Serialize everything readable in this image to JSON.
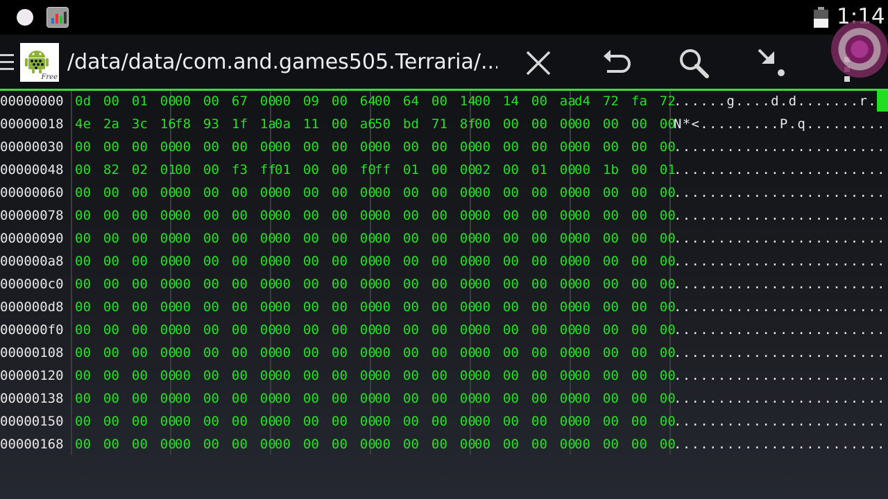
{
  "status_bar": {
    "time": "1:14",
    "icons": [
      "notification-dot-icon",
      "app-notification-icon",
      "battery-icon"
    ]
  },
  "action_bar": {
    "title": "/data/data/com.and.games505.Terraria/...",
    "app_logo_badge": "Free",
    "actions": [
      "close-icon",
      "undo-icon",
      "search-icon",
      "goto-icon",
      "overflow-menu-icon"
    ]
  },
  "colors": {
    "hex_text": "#22e022",
    "accent_line": "#33e233",
    "address_text": "#e8e8e8"
  },
  "rows": [
    {
      "addr": "00000000",
      "g": [
        "0d 00 01 00",
        "00 00 67 00",
        "00 09 00 64",
        "00 64 00 14",
        "00 14 00 aa",
        "d4 72 fa 72"
      ],
      "ascii": "......g....d.d.......r.r"
    },
    {
      "addr": "00000018",
      "g": [
        "4e 2a 3c 16",
        "f8 93 1f 1a",
        "0a 11 00 a6",
        "50 bd 71 8f",
        "00 00 00 00",
        "00 00 00 00"
      ],
      "ascii": "N*<.........P.q........."
    },
    {
      "addr": "00000030",
      "g": [
        "00 00 00 00",
        "00 00 00 00",
        "00 00 00 00",
        "00 00 00 00",
        "00 00 00 00",
        "00 00 00 00"
      ],
      "ascii": "........................"
    },
    {
      "addr": "00000048",
      "g": [
        "00 82 02 01",
        "00 00 f3 ff",
        "01 00 00 f0",
        "ff 01 00 00",
        "02 00 01 00",
        "00 1b 00 01"
      ],
      "ascii": "........................"
    },
    {
      "addr": "00000060",
      "g": [
        "00 00 00 00",
        "00 00 00 00",
        "00 00 00 00",
        "00 00 00 00",
        "00 00 00 00",
        "00 00 00 00"
      ],
      "ascii": "........................"
    },
    {
      "addr": "00000078",
      "g": [
        "00 00 00 00",
        "00 00 00 00",
        "00 00 00 00",
        "00 00 00 00",
        "00 00 00 00",
        "00 00 00 00"
      ],
      "ascii": "........................"
    },
    {
      "addr": "00000090",
      "g": [
        "00 00 00 00",
        "00 00 00 00",
        "00 00 00 00",
        "00 00 00 00",
        "00 00 00 00",
        "00 00 00 00"
      ],
      "ascii": "........................"
    },
    {
      "addr": "000000a8",
      "g": [
        "00 00 00 00",
        "00 00 00 00",
        "00 00 00 00",
        "00 00 00 00",
        "00 00 00 00",
        "00 00 00 00"
      ],
      "ascii": "........................"
    },
    {
      "addr": "000000c0",
      "g": [
        "00 00 00 00",
        "00 00 00 00",
        "00 00 00 00",
        "00 00 00 00",
        "00 00 00 00",
        "00 00 00 00"
      ],
      "ascii": "........................"
    },
    {
      "addr": "000000d8",
      "g": [
        "00 00 00 00",
        "00 00 00 00",
        "00 00 00 00",
        "00 00 00 00",
        "00 00 00 00",
        "00 00 00 00"
      ],
      "ascii": "........................"
    },
    {
      "addr": "000000f0",
      "g": [
        "00 00 00 00",
        "00 00 00 00",
        "00 00 00 00",
        "00 00 00 00",
        "00 00 00 00",
        "00 00 00 00"
      ],
      "ascii": "........................"
    },
    {
      "addr": "00000108",
      "g": [
        "00 00 00 00",
        "00 00 00 00",
        "00 00 00 00",
        "00 00 00 00",
        "00 00 00 00",
        "00 00 00 00"
      ],
      "ascii": "........................"
    },
    {
      "addr": "00000120",
      "g": [
        "00 00 00 00",
        "00 00 00 00",
        "00 00 00 00",
        "00 00 00 00",
        "00 00 00 00",
        "00 00 00 00"
      ],
      "ascii": "........................"
    },
    {
      "addr": "00000138",
      "g": [
        "00 00 00 00",
        "00 00 00 00",
        "00 00 00 00",
        "00 00 00 00",
        "00 00 00 00",
        "00 00 00 00"
      ],
      "ascii": "........................"
    },
    {
      "addr": "00000150",
      "g": [
        "00 00 00 00",
        "00 00 00 00",
        "00 00 00 00",
        "00 00 00 00",
        "00 00 00 00",
        "00 00 00 00"
      ],
      "ascii": "........................"
    },
    {
      "addr": "00000168",
      "g": [
        "00 00 00 00",
        "00 00 00 00",
        "00 00 00 00",
        "00 00 00 00",
        "00 00 00 00",
        "00 00 00 00"
      ],
      "ascii": "........................"
    }
  ]
}
